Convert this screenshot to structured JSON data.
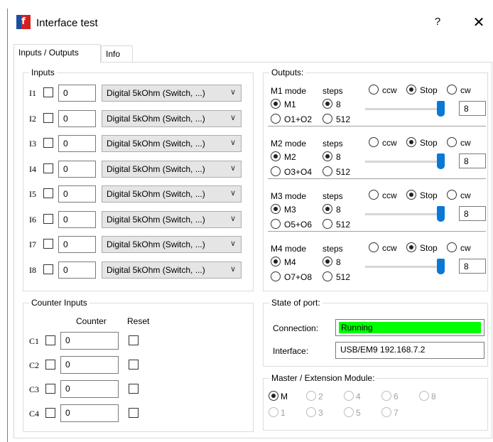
{
  "window": {
    "title": "Interface test",
    "help": "?",
    "close": "✕"
  },
  "tabs": [
    "Inputs / Outputs",
    "Info"
  ],
  "inputs": {
    "title": "Inputs",
    "rows": [
      {
        "label": "I1",
        "value": "0",
        "mode": "Digital 5kOhm (Switch, ...)"
      },
      {
        "label": "I2",
        "value": "0",
        "mode": "Digital 5kOhm (Switch, ...)"
      },
      {
        "label": "I3",
        "value": "0",
        "mode": "Digital 5kOhm (Switch, ...)"
      },
      {
        "label": "I4",
        "value": "0",
        "mode": "Digital 5kOhm (Switch, ...)"
      },
      {
        "label": "I5",
        "value": "0",
        "mode": "Digital 5kOhm (Switch, ...)"
      },
      {
        "label": "I6",
        "value": "0",
        "mode": "Digital 5kOhm (Switch, ...)"
      },
      {
        "label": "I7",
        "value": "0",
        "mode": "Digital 5kOhm (Switch, ...)"
      },
      {
        "label": "I8",
        "value": "0",
        "mode": "Digital 5kOhm (Switch, ...)"
      }
    ]
  },
  "outputs": {
    "title": "Outputs:",
    "motors": [
      {
        "mode_label": "M1 mode",
        "steps_label": "steps",
        "opt_motor": "M1",
        "opt_outputs": "O1+O2",
        "step_hi": "8",
        "step_lo": "512",
        "ccw": "ccw",
        "stop": "Stop",
        "cw": "cw",
        "speed": "8",
        "slider_level": 1.0
      },
      {
        "mode_label": "M2 mode",
        "steps_label": "steps",
        "opt_motor": "M2",
        "opt_outputs": "O3+O4",
        "step_hi": "8",
        "step_lo": "512",
        "ccw": "ccw",
        "stop": "Stop",
        "cw": "cw",
        "speed": "8",
        "slider_level": 1.0
      },
      {
        "mode_label": "M3 mode",
        "steps_label": "steps",
        "opt_motor": "M3",
        "opt_outputs": "O5+O6",
        "step_hi": "8",
        "step_lo": "512",
        "ccw": "ccw",
        "stop": "Stop",
        "cw": "cw",
        "speed": "8",
        "slider_level": 1.0
      },
      {
        "mode_label": "M4 mode",
        "steps_label": "steps",
        "opt_motor": "M4",
        "opt_outputs": "O7+O8",
        "step_hi": "8",
        "step_lo": "512",
        "ccw": "ccw",
        "stop": "Stop",
        "cw": "cw",
        "speed": "8",
        "slider_level": 1.0
      }
    ]
  },
  "counters": {
    "title": "Counter Inputs",
    "col_counter": "Counter",
    "col_reset": "Reset",
    "rows": [
      {
        "label": "C1",
        "value": "0"
      },
      {
        "label": "C2",
        "value": "0"
      },
      {
        "label": "C3",
        "value": "0"
      },
      {
        "label": "C4",
        "value": "0"
      }
    ]
  },
  "port": {
    "title": "State of port:",
    "connection_label": "Connection:",
    "connection_value": "Running",
    "interface_label": "Interface:",
    "interface_value": "USB/EM9 192.168.7.2",
    "running_color": "#00ff00"
  },
  "module": {
    "title": "Master / Extension Module:",
    "options": [
      "M",
      "2",
      "4",
      "6",
      "8",
      "1",
      "3",
      "5",
      "7"
    ],
    "selected": "M"
  }
}
